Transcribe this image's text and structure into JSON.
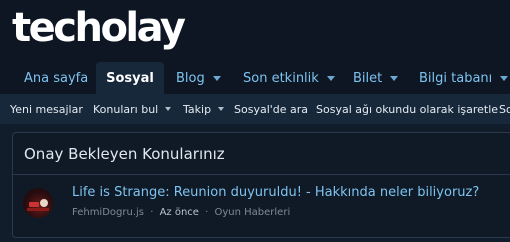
{
  "site": {
    "logo_text": "techolay"
  },
  "nav": {
    "tabs": [
      {
        "label": "Ana sayfa",
        "has_dropdown": false
      },
      {
        "label": "Sosyal",
        "has_dropdown": false,
        "active": true
      },
      {
        "label": "Blog",
        "has_dropdown": true
      },
      {
        "label": "Son etkinlik",
        "has_dropdown": true
      },
      {
        "label": "Bilet",
        "has_dropdown": true
      },
      {
        "label": "Bilgi tabanı",
        "has_dropdown": true
      }
    ]
  },
  "subnav": {
    "items": [
      {
        "label": "Yeni mesajlar",
        "has_dropdown": false
      },
      {
        "label": "Konuları bul",
        "has_dropdown": true
      },
      {
        "label": "Takip",
        "has_dropdown": true
      },
      {
        "label": "Sosyal'de ara",
        "has_dropdown": false
      },
      {
        "label": "Sosyal ağı okundu olarak işaretle",
        "has_dropdown": false
      },
      {
        "label": "So",
        "has_dropdown": false
      }
    ]
  },
  "block": {
    "title": "Onay Bekleyen Konularınız",
    "items": [
      {
        "title": "Life is Strange: Reunion duyuruldu! - Hakkında neler biliyoruz?",
        "author": "FehmiDogru.js",
        "separator": "·",
        "time": "Az önce",
        "forum": "Oyun Haberleri"
      }
    ]
  },
  "colors": {
    "page_bg": "#111d2b",
    "header_bg": "#0d1622",
    "subnav_bg": "#16283a",
    "link": "#7ec3f0",
    "text": "#e4ebf2",
    "muted": "#7e8a97"
  }
}
